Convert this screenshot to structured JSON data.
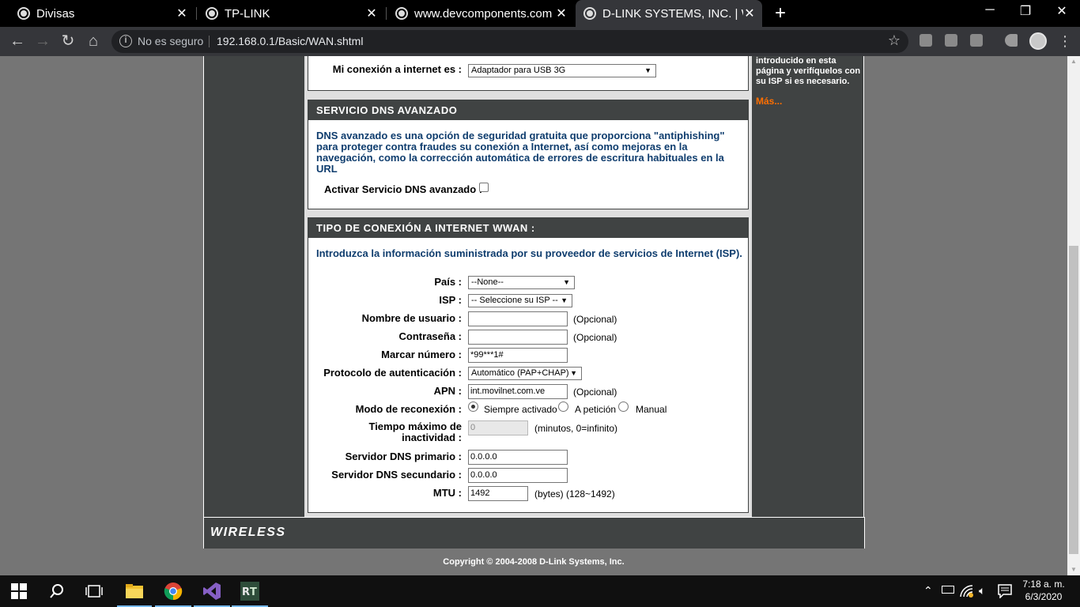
{
  "browser": {
    "tabs": [
      {
        "title": "Divisas",
        "active": false
      },
      {
        "title": "TP-LINK",
        "active": false
      },
      {
        "title": "www.devcomponents.com",
        "active": false
      },
      {
        "title": "D-LINK SYSTEMS, INC. | W",
        "active": true
      }
    ],
    "security_label": "No es seguro",
    "url": "192.168.0.1/Basic/WAN.shtml"
  },
  "page": {
    "connection_label": "Mi conexión a internet es :",
    "connection_value": "Adaptador para USB 3G",
    "help_text": "introducido en esta página y verifíquelos con su ISP si es necesario.",
    "help_more": "Más...",
    "dns": {
      "title": "SERVICIO DNS AVANZADO",
      "description": "DNS avanzado es una opción de seguridad gratuita que proporciona \"antiphishing\" para proteger contra fraudes su conexión a Internet, así como mejoras en la navegación, como la corrección automática de errores de escritura habituales en la URL",
      "enable_label": "Activar Servicio DNS avanzado :",
      "enabled": false
    },
    "wwan": {
      "title": "TIPO DE CONEXIÓN A INTERNET WWAN :",
      "intro": "Introduzca la información suministrada por su proveedor de servicios de Internet (ISP).",
      "country_label": "País :",
      "country_value": "--None--",
      "isp_label": "ISP :",
      "isp_value": "-- Seleccione su ISP --",
      "username_label": "Nombre de usuario :",
      "username_value": "",
      "password_label": "Contraseña :",
      "password_value": "",
      "optional_note": "(Opcional)",
      "dial_label": "Marcar número :",
      "dial_value": "*99***1#",
      "auth_label": "Protocolo de autenticación :",
      "auth_value": "Automático (PAP+CHAP)",
      "apn_label": "APN :",
      "apn_value": "int.movilnet.com.ve",
      "reconnect_label": "Modo de reconexión :",
      "reconnect_options": [
        "Siempre activado",
        "A petición",
        "Manual"
      ],
      "reconnect_selected": "Siempre activado",
      "idle_label_line1": "Tiempo máximo de",
      "idle_label_line2": "inactividad :",
      "idle_value": "0",
      "idle_note": "(minutos, 0=infinito)",
      "dns1_label": "Servidor DNS primario :",
      "dns1_value": "0.0.0.0",
      "dns2_label": "Servidor DNS secundario :",
      "dns2_value": "0.0.0.0",
      "mtu_label": "MTU :",
      "mtu_value": "1492",
      "mtu_note": "(bytes) (128~1492)"
    },
    "footer_logo": "WIRELESS",
    "copyright": "Copyright © 2004-2008 D-Link Systems, Inc."
  },
  "taskbar": {
    "time": "7:18 a. m.",
    "date": "6/3/2020"
  },
  "colors": {
    "header_bg": "#404343",
    "content_bg": "#dfdfdf",
    "page_bg": "#757575",
    "blue_text": "#0f3d6e",
    "help_link": "#ff6f00"
  }
}
